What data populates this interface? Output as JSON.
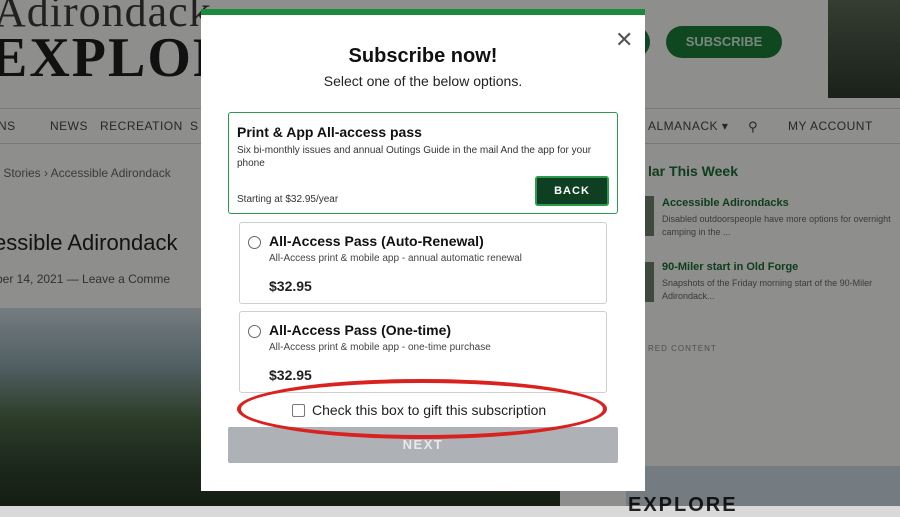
{
  "background_site": {
    "logo_line1": "Adirondack",
    "logo_line2": "EXPLORER",
    "header_button_left": "",
    "header_button_subscribe": "SUBSCRIBE",
    "nav_items": [
      "NS",
      "NEWS",
      "RECREATION",
      "S",
      "ALMANACK ▾",
      "MY ACCOUNT"
    ],
    "breadcrumb": "› Stories › Accessible Adirondack",
    "article_title": "essible Adirondack",
    "article_date": "ber 14, 2021 — Leave a Comme",
    "sidebar_heading": "lar This Week",
    "sidebar_items": [
      {
        "title": "Accessible Adirondacks",
        "snippet": "Disabled outdoorspeople have more options for overnight camping in the ..."
      },
      {
        "title": "90-Miler start in Old Forge",
        "snippet": "Snapshots of the Friday morning start of the 90-Miler Adirondack..."
      }
    ],
    "sidebar_small": "RED CONTENT",
    "sidebar_explore": "EXPLORE"
  },
  "modal": {
    "close_glyph": "✕",
    "title": "Subscribe now!",
    "subtitle": "Select one of the below options.",
    "pass": {
      "title": "Print & App All-access pass",
      "description": "Six bi-monthly issues and annual Outings Guide in the mail And the app for your phone",
      "starting_price": "Starting at $32.95/year",
      "back_label": "BACK"
    },
    "options": [
      {
        "title": "All-Access Pass (Auto-Renewal)",
        "description": "All-Access print & mobile app - annual automatic renewal",
        "price": "$32.95"
      },
      {
        "title": "All-Access Pass (One-time)",
        "description": "All-Access print & mobile app - one-time purchase",
        "price": "$32.95"
      }
    ],
    "gift_label": "Check this box to gift this subscription",
    "next_label": "NEXT"
  },
  "colors": {
    "brand_green": "#1b8a3c",
    "back_button": "#0e3f22",
    "highlight_ellipse": "#d9221f",
    "next_disabled": "#aeb2b6"
  }
}
